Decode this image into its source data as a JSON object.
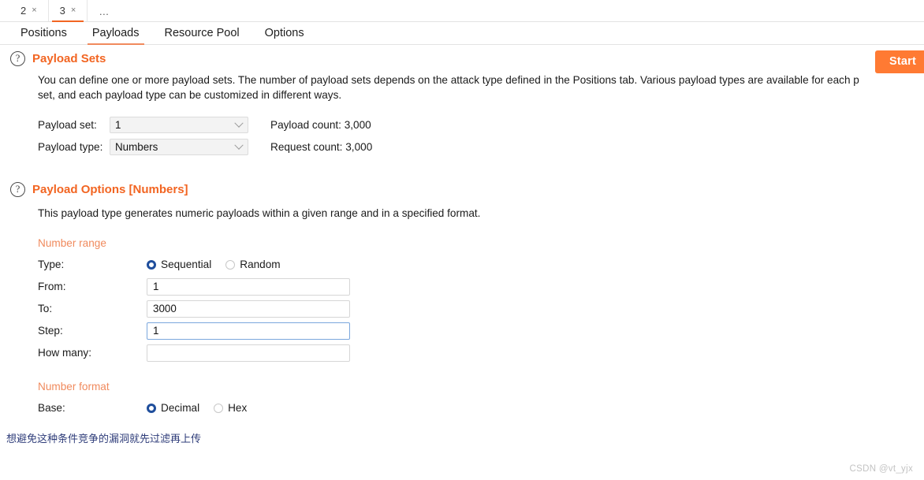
{
  "window": {
    "numbered_tabs": [
      {
        "label": "2",
        "close": "×",
        "active": false
      },
      {
        "label": "3",
        "close": "×",
        "active": true
      }
    ],
    "overflow_label": "…"
  },
  "section_tabs": [
    {
      "label": "Positions",
      "active": false
    },
    {
      "label": "Payloads",
      "active": true
    },
    {
      "label": "Resource Pool",
      "active": false
    },
    {
      "label": "Options",
      "active": false
    }
  ],
  "start_button": {
    "label": "Start"
  },
  "payload_sets": {
    "help_icon": "?",
    "title": "Payload Sets",
    "description_line1": "You can define one or more payload sets. The number of payload sets depends on the attack type defined in the Positions tab. Various payload types are available for each p",
    "description_line2": "set, and each payload type can be customized in different ways.",
    "payload_set_label": "Payload set:",
    "payload_set_value": "1",
    "payload_type_label": "Payload type:",
    "payload_type_value": "Numbers",
    "payload_count_label": "Payload count:",
    "payload_count_value": "3,000",
    "request_count_label": "Request count:",
    "request_count_value": "3,000"
  },
  "payload_options": {
    "help_icon": "?",
    "title": "Payload Options [Numbers]",
    "description": "This payload type generates numeric payloads within a given range and in a specified format.",
    "number_range": {
      "heading": "Number range",
      "type_label": "Type:",
      "type_options": [
        {
          "label": "Sequential",
          "selected": true
        },
        {
          "label": "Random",
          "selected": false
        }
      ],
      "from_label": "From:",
      "from_value": "1",
      "to_label": "To:",
      "to_value": "3000",
      "step_label": "Step:",
      "step_value": "1",
      "how_many_label": "How many:",
      "how_many_value": ""
    },
    "number_format": {
      "heading": "Number format",
      "base_label": "Base:",
      "base_options": [
        {
          "label": "Decimal",
          "selected": true
        },
        {
          "label": "Hex",
          "selected": false
        }
      ]
    }
  },
  "caption": "想避免这种条件竞争的漏洞就先过滤再上传",
  "watermark": "CSDN @vt_yjx",
  "colors": {
    "accent_orange": "#f26522",
    "start_button": "#ff7a33",
    "radio_selected": "#1f4e9c",
    "focus_border": "#7ba7dd"
  }
}
